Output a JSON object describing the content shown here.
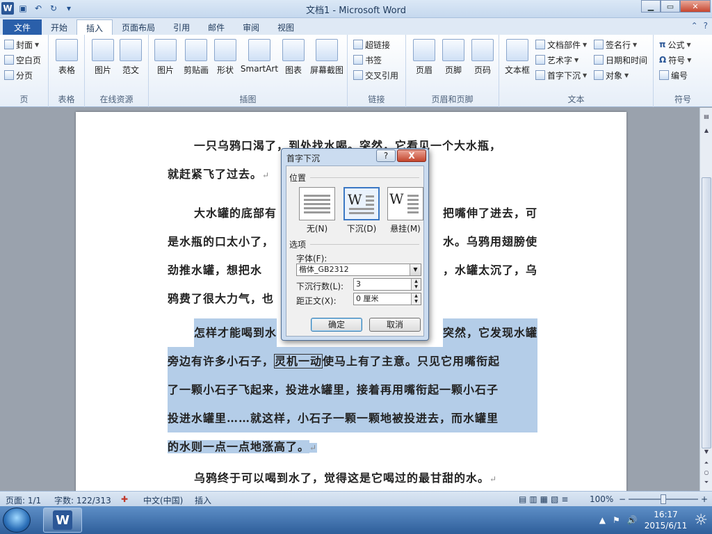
{
  "window": {
    "title": "文档1 - Microsoft Word",
    "minimize": "▁",
    "maximize": "▭",
    "close": "✕"
  },
  "tabs": [
    {
      "label": "文件"
    },
    {
      "label": "开始"
    },
    {
      "label": "插入"
    },
    {
      "label": "页面布局"
    },
    {
      "label": "引用"
    },
    {
      "label": "邮件"
    },
    {
      "label": "审阅"
    },
    {
      "label": "视图"
    }
  ],
  "ribbon": {
    "pages": {
      "cover": "封面",
      "blank": "空白页",
      "break": "分页",
      "label": "页"
    },
    "tables": {
      "table": "表格",
      "label": "表格"
    },
    "online": {
      "picture": "图片",
      "template": "范文",
      "label": "在线资源"
    },
    "illustrations": {
      "picture": "图片",
      "clipart": "剪贴画",
      "shapes": "形状",
      "smartart": "SmartArt",
      "chart": "图表",
      "screenshot": "屏幕截图",
      "label": "插图"
    },
    "links": {
      "hyperlink": "超链接",
      "bookmark": "书签",
      "crossref": "交叉引用",
      "label": "链接"
    },
    "headerfooter": {
      "header": "页眉",
      "footer": "页脚",
      "pagenum": "页码",
      "label": "页眉和页脚"
    },
    "text": {
      "textbox": "文本框",
      "parts": "文档部件",
      "wordart": "艺术字",
      "dropcap": "首字下沉",
      "signature": "签名行",
      "datetime": "日期和时间",
      "object": "对象",
      "label": "文本"
    },
    "symbols": {
      "equation": "公式",
      "symbol": "符号",
      "number": "编号",
      "label": "符号"
    }
  },
  "document": {
    "p1a": "一只乌鸦口渴了，到处找水喝。突然，它看见一个大水瓶，",
    "p1b": "就赶紧飞了过去。",
    "p2a": "大水罐的底部有",
    "p2a2": "把嘴伸了进去，可",
    "p2b": "是水瓶的口太小了，",
    "p2b2": "水。乌鸦用翅膀使",
    "p2c": "劲推水罐，想把水",
    "p2c2": "，水罐太沉了，乌",
    "p2d": "鸦费了很大力气，也",
    "p3a": "怎样才能喝到水",
    "p3a2": "突然，它发现水罐",
    "p3b1": "旁边有许多小石子，",
    "p3b2": "灵机一动",
    "p3b3": "使马上有了主意。只见它用嘴衔起",
    "p3c": "了一颗小石子飞起来，投进水罐里，接着再用嘴衔起一颗小石子",
    "p3d": "投进水罐里……就这样，小石子一颗一颗地被投进去，而水罐里",
    "p3e": "的水则一点一点地涨高了。",
    "p4": "乌鸦终于可以喝到水了，觉得这是它喝过的最甘甜的水。",
    "ret": "↵"
  },
  "dialog": {
    "title": "首字下沉",
    "help": "?",
    "close": "X",
    "position_label": "位置",
    "options": [
      {
        "label": "无(N)"
      },
      {
        "label": "下沉(D)"
      },
      {
        "label": "悬挂(M)"
      }
    ],
    "selected": "下沉(D)",
    "section_options": "选项",
    "font_label": "字体(F):",
    "font_value": "楷体_GB2312",
    "lines_label": "下沉行数(L):",
    "lines_value": "3",
    "distance_label": "距正文(X):",
    "distance_value": "0 厘米",
    "ok": "确定",
    "cancel": "取消"
  },
  "status": {
    "page": "页面: 1/1",
    "words": "字数: 122/313",
    "lang": "中文(中国)",
    "mode": "插入",
    "zoom": "100%",
    "minus": "−",
    "plus": "+"
  },
  "taskbar": {
    "time": "16:17",
    "date": "2015/6/11"
  },
  "colors": {
    "accent": "#2a5faa",
    "highlight": "#b4cde8",
    "dialog": "#cbdcf0"
  }
}
